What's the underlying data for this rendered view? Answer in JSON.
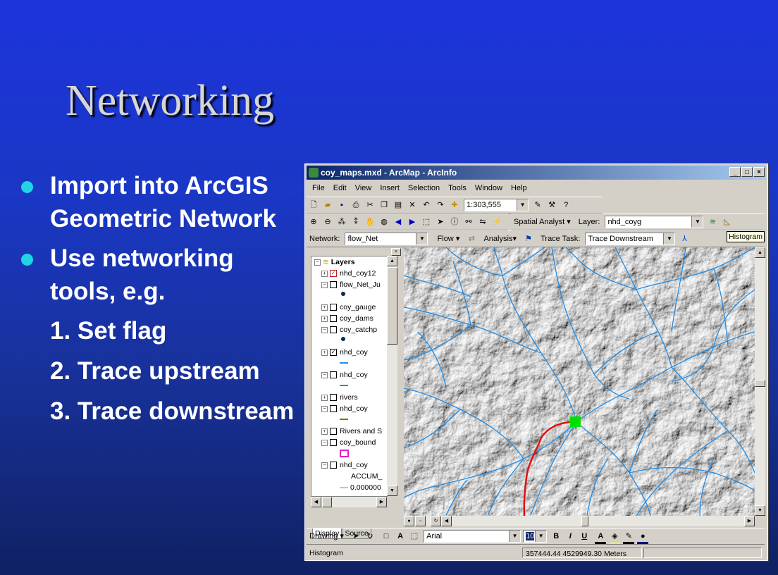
{
  "slide": {
    "title": "Networking",
    "bullets": [
      {
        "text": "Import into ArcGIS Geometric Network"
      },
      {
        "text": "Use networking tools, e.g."
      }
    ],
    "steps": [
      "1. Set flag",
      "2. Trace upstream",
      "3. Trace downstream"
    ]
  },
  "window": {
    "title": "coy_maps.mxd - ArcMap - ArcInfo",
    "buttons": [
      "_",
      "□",
      "×"
    ]
  },
  "menu": [
    "File",
    "Edit",
    "View",
    "Insert",
    "Selection",
    "Tools",
    "Window",
    "Help"
  ],
  "toolbar": {
    "scale": "1:303,555",
    "spatial_analyst": "Spatial Analyst",
    "layer_label": "Layer:",
    "layer_value": "nhd_coyg",
    "histogram_tip": "Histogram"
  },
  "network_toolbar": {
    "network_label": "Network:",
    "network_value": "flow_Net",
    "flow": "Flow",
    "analysis": "Analysis",
    "trace_task_label": "Trace Task:",
    "trace_task_value": "Trace Downstream"
  },
  "toc": {
    "root": "Layers",
    "items": [
      {
        "label": "nhd_coy12"
      },
      {
        "label": "flow_Net_Ju"
      },
      {
        "label": "coy_gauge"
      },
      {
        "label": "coy_dams"
      },
      {
        "label": "coy_catchp"
      },
      {
        "label": "nhd_coy"
      },
      {
        "label": "nhd_coy"
      },
      {
        "label": "rivers"
      },
      {
        "label": "nhd_coy"
      },
      {
        "label": "Rivers and S"
      },
      {
        "label": "coy_bound"
      },
      {
        "label": "nhd_coy"
      },
      {
        "label": "ACCUM_"
      },
      {
        "label": "0.000000"
      }
    ],
    "tabs": [
      "Display",
      "Source"
    ]
  },
  "drawing_toolbar": {
    "drawing": "Drawing",
    "font": "Arial",
    "size": "10",
    "bold": "B",
    "italic": "I",
    "underline": "U"
  },
  "status": {
    "left": "Histogram",
    "coords": "357444.44  4529949.30 Meters"
  },
  "colors": {
    "stream": "#1e8ce6",
    "trace": "#e01010",
    "flag": "#00e000",
    "bullet": "#1fd5e3"
  }
}
